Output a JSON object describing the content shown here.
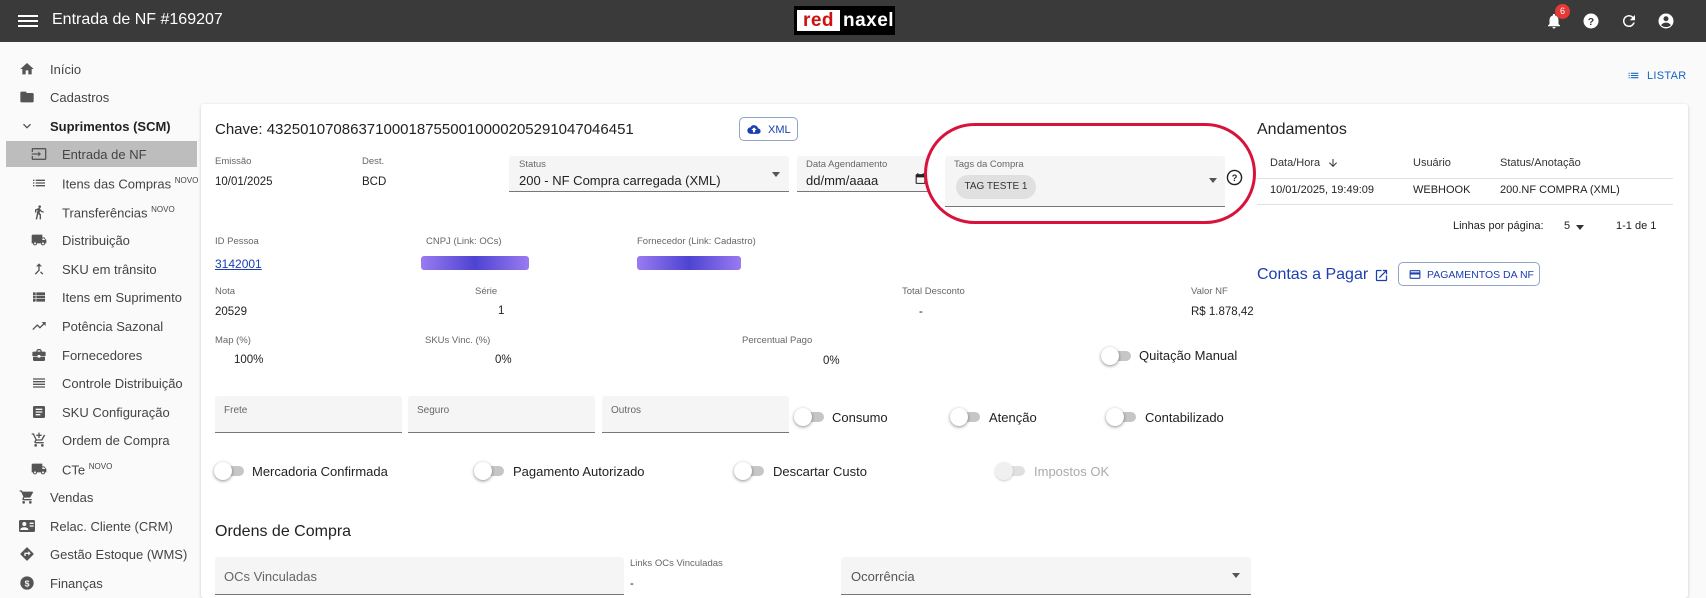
{
  "header": {
    "title": "Entrada de NF #169207",
    "logo_left": "red",
    "logo_right": "naxel",
    "notif_count": "6"
  },
  "sidebar": {
    "items": [
      {
        "label": "Início",
        "sup": ""
      },
      {
        "label": "Cadastros",
        "sup": ""
      },
      {
        "label": "Suprimentos (SCM)",
        "sup": ""
      },
      {
        "label": "Entrada de NF",
        "sup": ""
      },
      {
        "label": "Itens das Compras",
        "sup": "NOVO"
      },
      {
        "label": "Transferências",
        "sup": "NOVO"
      },
      {
        "label": "Distribuição",
        "sup": ""
      },
      {
        "label": "SKU em trânsito",
        "sup": ""
      },
      {
        "label": "Itens em Suprimento",
        "sup": ""
      },
      {
        "label": "Potência Sazonal",
        "sup": ""
      },
      {
        "label": "Fornecedores",
        "sup": ""
      },
      {
        "label": "Controle Distribuição",
        "sup": ""
      },
      {
        "label": "SKU Configuração",
        "sup": ""
      },
      {
        "label": "Ordem de Compra",
        "sup": ""
      },
      {
        "label": "CTe",
        "sup": "NOVO"
      },
      {
        "label": "Vendas",
        "sup": ""
      },
      {
        "label": "Relac. Cliente (CRM)",
        "sup": ""
      },
      {
        "label": "Gestão Estoque (WMS)",
        "sup": ""
      },
      {
        "label": "Finanças",
        "sup": ""
      }
    ]
  },
  "listar": "LISTAR",
  "nf": {
    "chave": "Chave: 43250107086371000187550010000205291047046451",
    "xml_button": "XML",
    "emissao_label": "Emissão",
    "emissao": "10/01/2025",
    "dest_label": "Dest.",
    "dest": "BCD",
    "status_label": "Status",
    "status": "200 - NF Compra carregada (XML)",
    "agendamento_label": "Data Agendamento",
    "agendamento_placeholder": "dd/mm/aaaa",
    "tags_label": "Tags da Compra",
    "tag": "TAG TESTE 1",
    "id_pessoa_label": "ID Pessoa",
    "id_pessoa": "3142001",
    "cnpj_label": "CNPJ (Link: OCs)",
    "fornecedor_label": "Fornecedor (Link: Cadastro)",
    "nota_label": "Nota",
    "nota": "20529",
    "serie_label": "Série",
    "serie": "1",
    "desconto_label": "Total Desconto",
    "desconto": "-",
    "valor_label": "Valor NF",
    "valor": "R$ 1.878,42",
    "map_label": "Map (%)",
    "map": "100%",
    "skus_label": "SKUs Vinc. (%)",
    "skus": "0%",
    "pago_label": "Percentual Pago",
    "pago": "0%",
    "frete_label": "Frete",
    "seguro_label": "Seguro",
    "outros_label": "Outros"
  },
  "toggles": {
    "quitacao": "Quitação Manual",
    "consumo": "Consumo",
    "atencao": "Atenção",
    "contabilizado": "Contabilizado",
    "mercadoria": "Mercadoria Confirmada",
    "pagamento": "Pagamento Autorizado",
    "descartar": "Descartar Custo",
    "impostos": "Impostos OK"
  },
  "ordens": {
    "title": "Ordens de Compra",
    "ocs_placeholder": "OCs Vinculadas",
    "links_label": "Links OCs Vinculadas",
    "links_value": "-",
    "ocorrencia": "Ocorrência"
  },
  "andamentos": {
    "title": "Andamentos",
    "columns": [
      "Data/Hora",
      "Usuário",
      "Status/Anotação"
    ],
    "rows": [
      [
        "10/01/2025, 19:49:09",
        "WEBHOOK",
        "200.NF COMPRA (XML)"
      ]
    ],
    "rows_per_page_label": "Linhas por página:",
    "rows_per_page": "5",
    "range": "1-1 de 1"
  },
  "contas": {
    "title": "Contas a Pagar",
    "button": "PAGAMENTOS DA NF"
  },
  "colors": {
    "accent": "#1a3fb0",
    "highlight": "#d9123c",
    "topbar": "#3a3a3a"
  }
}
